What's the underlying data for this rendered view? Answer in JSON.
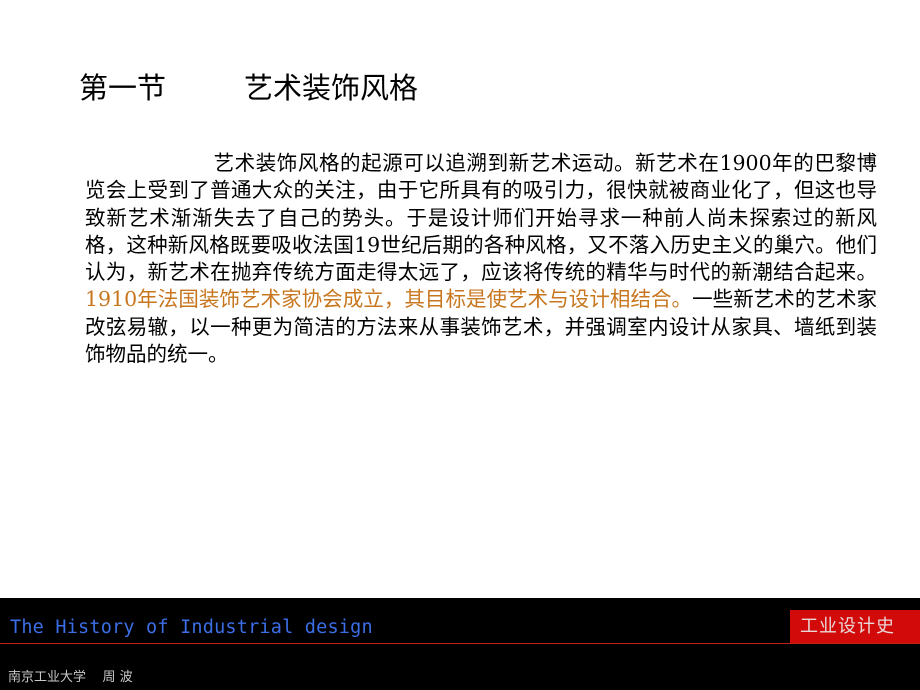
{
  "slide": {
    "section": "第一节",
    "title": "艺术装饰风格",
    "paragraph": {
      "part1": "艺术装饰风格的起源可以追溯到新艺术运动。新艺术在1900年的巴黎博览会上受到了普通大众的关注，由于它所具有的吸引力，很快就被商业化了，但这也导致新艺术渐渐失去了自己的势头。于是设计师们开始寻求一种前人尚未探索过的新风格，这种新风格既要吸收法国19世纪后期的各种风格，又不落入历史主义的巢穴。他们认为，新艺术在抛弃传统方面走得太远了，应该将传统的精华与时代的新潮结合起来。",
      "highlight": "1910年法国装饰艺术家协会成立，其目标是使艺术与设计相结合。",
      "part2": "一些新艺术的艺术家改弦易辙，以一种更为简洁的方法来从事装饰艺术，并强调室内设计从家具、墙纸到装饰物品的统一。"
    },
    "highlight_color": "#c8761e"
  },
  "footer": {
    "english_title": "The History of Industrial design",
    "badge": "工业设计史",
    "author": "南京工业大学    周 波",
    "colors": {
      "background": "#000000",
      "english_title": "#3b6ee6",
      "badge_bg": "#d20a0a",
      "line": "#c0231a"
    }
  }
}
